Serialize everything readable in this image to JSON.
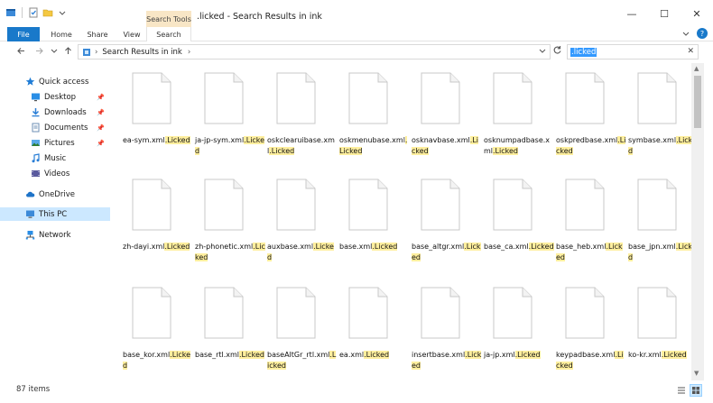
{
  "window": {
    "title": ".licked - Search Results in ink",
    "contextual_tab": "Search Tools",
    "controls": {
      "minimize": "—",
      "maximize": "☐",
      "close": "✕"
    }
  },
  "ribbon": {
    "tabs": [
      "File",
      "Home",
      "Share",
      "View",
      "Search"
    ]
  },
  "address": {
    "location": "Search Results in ink",
    "search_value": ".licked"
  },
  "sidebar": {
    "items": [
      {
        "label": "Quick access",
        "icon": "star-icon"
      },
      {
        "label": "Desktop",
        "icon": "desktop-icon"
      },
      {
        "label": "Downloads",
        "icon": "downloads-icon"
      },
      {
        "label": "Documents",
        "icon": "documents-icon"
      },
      {
        "label": "Pictures",
        "icon": "pictures-icon"
      },
      {
        "label": "Music",
        "icon": "music-icon"
      },
      {
        "label": "Videos",
        "icon": "videos-icon"
      },
      {
        "label": "OneDrive",
        "icon": "onedrive-icon"
      },
      {
        "label": "This PC",
        "icon": "this-pc-icon"
      },
      {
        "label": "Network",
        "icon": "network-icon"
      }
    ]
  },
  "files": [
    {
      "pre": "ea-sym.xml",
      "hl": ".Licked",
      "post": ""
    },
    {
      "pre": "ja-jp-sym.xml",
      "hl": ".Licked",
      "post": ""
    },
    {
      "pre": "oskclearuibase.xml",
      "hl": ".Licked",
      "post": ""
    },
    {
      "pre": "oskmenubase.xml",
      "hl": ".Licked",
      "post": ""
    },
    {
      "pre": "osknavbase.xml",
      "hl": ".Licked",
      "post": ""
    },
    {
      "pre": "osknumpadbase.xml",
      "hl": ".Licked",
      "post": ""
    },
    {
      "pre": "oskpredbase.xml",
      "hl": ".Licked",
      "post": ""
    },
    {
      "pre": "symbase.xml",
      "hl": ".Licked",
      "post": ""
    },
    {
      "pre": "zh-dayi.xml",
      "hl": ".Licked",
      "post": ""
    },
    {
      "pre": "zh-phonetic.xml",
      "hl": ".Licked",
      "post": ""
    },
    {
      "pre": "auxbase.xml",
      "hl": ".Licked",
      "post": ""
    },
    {
      "pre": "base.xml",
      "hl": ".Licked",
      "post": ""
    },
    {
      "pre": "base_altgr.xml",
      "hl": ".Licked",
      "post": ""
    },
    {
      "pre": "base_ca.xml",
      "hl": ".Licked",
      "post": ""
    },
    {
      "pre": "base_heb.xml",
      "hl": ".Licked",
      "post": ""
    },
    {
      "pre": "base_jpn.xml",
      "hl": ".Licked",
      "post": ""
    },
    {
      "pre": "base_kor.xml",
      "hl": ".Licked",
      "post": ""
    },
    {
      "pre": "base_rtl.xml",
      "hl": ".Licked",
      "post": ""
    },
    {
      "pre": "baseAltGr_rtl.xml",
      "hl": ".Licked",
      "post": ""
    },
    {
      "pre": "ea.xml",
      "hl": ".Licked",
      "post": ""
    },
    {
      "pre": "insertbase.xml",
      "hl": ".Licked",
      "post": ""
    },
    {
      "pre": "ja-jp.xml",
      "hl": ".Licked",
      "post": ""
    },
    {
      "pre": "keypadbase.xml",
      "hl": ".Licked",
      "post": ""
    },
    {
      "pre": "ko-kr.xml",
      "hl": ".Licked",
      "post": ""
    }
  ],
  "status": {
    "item_count": "87 items"
  },
  "colors": {
    "accent": "#1979ca",
    "highlight": "#ffef9e",
    "selection": "#cce8ff"
  }
}
